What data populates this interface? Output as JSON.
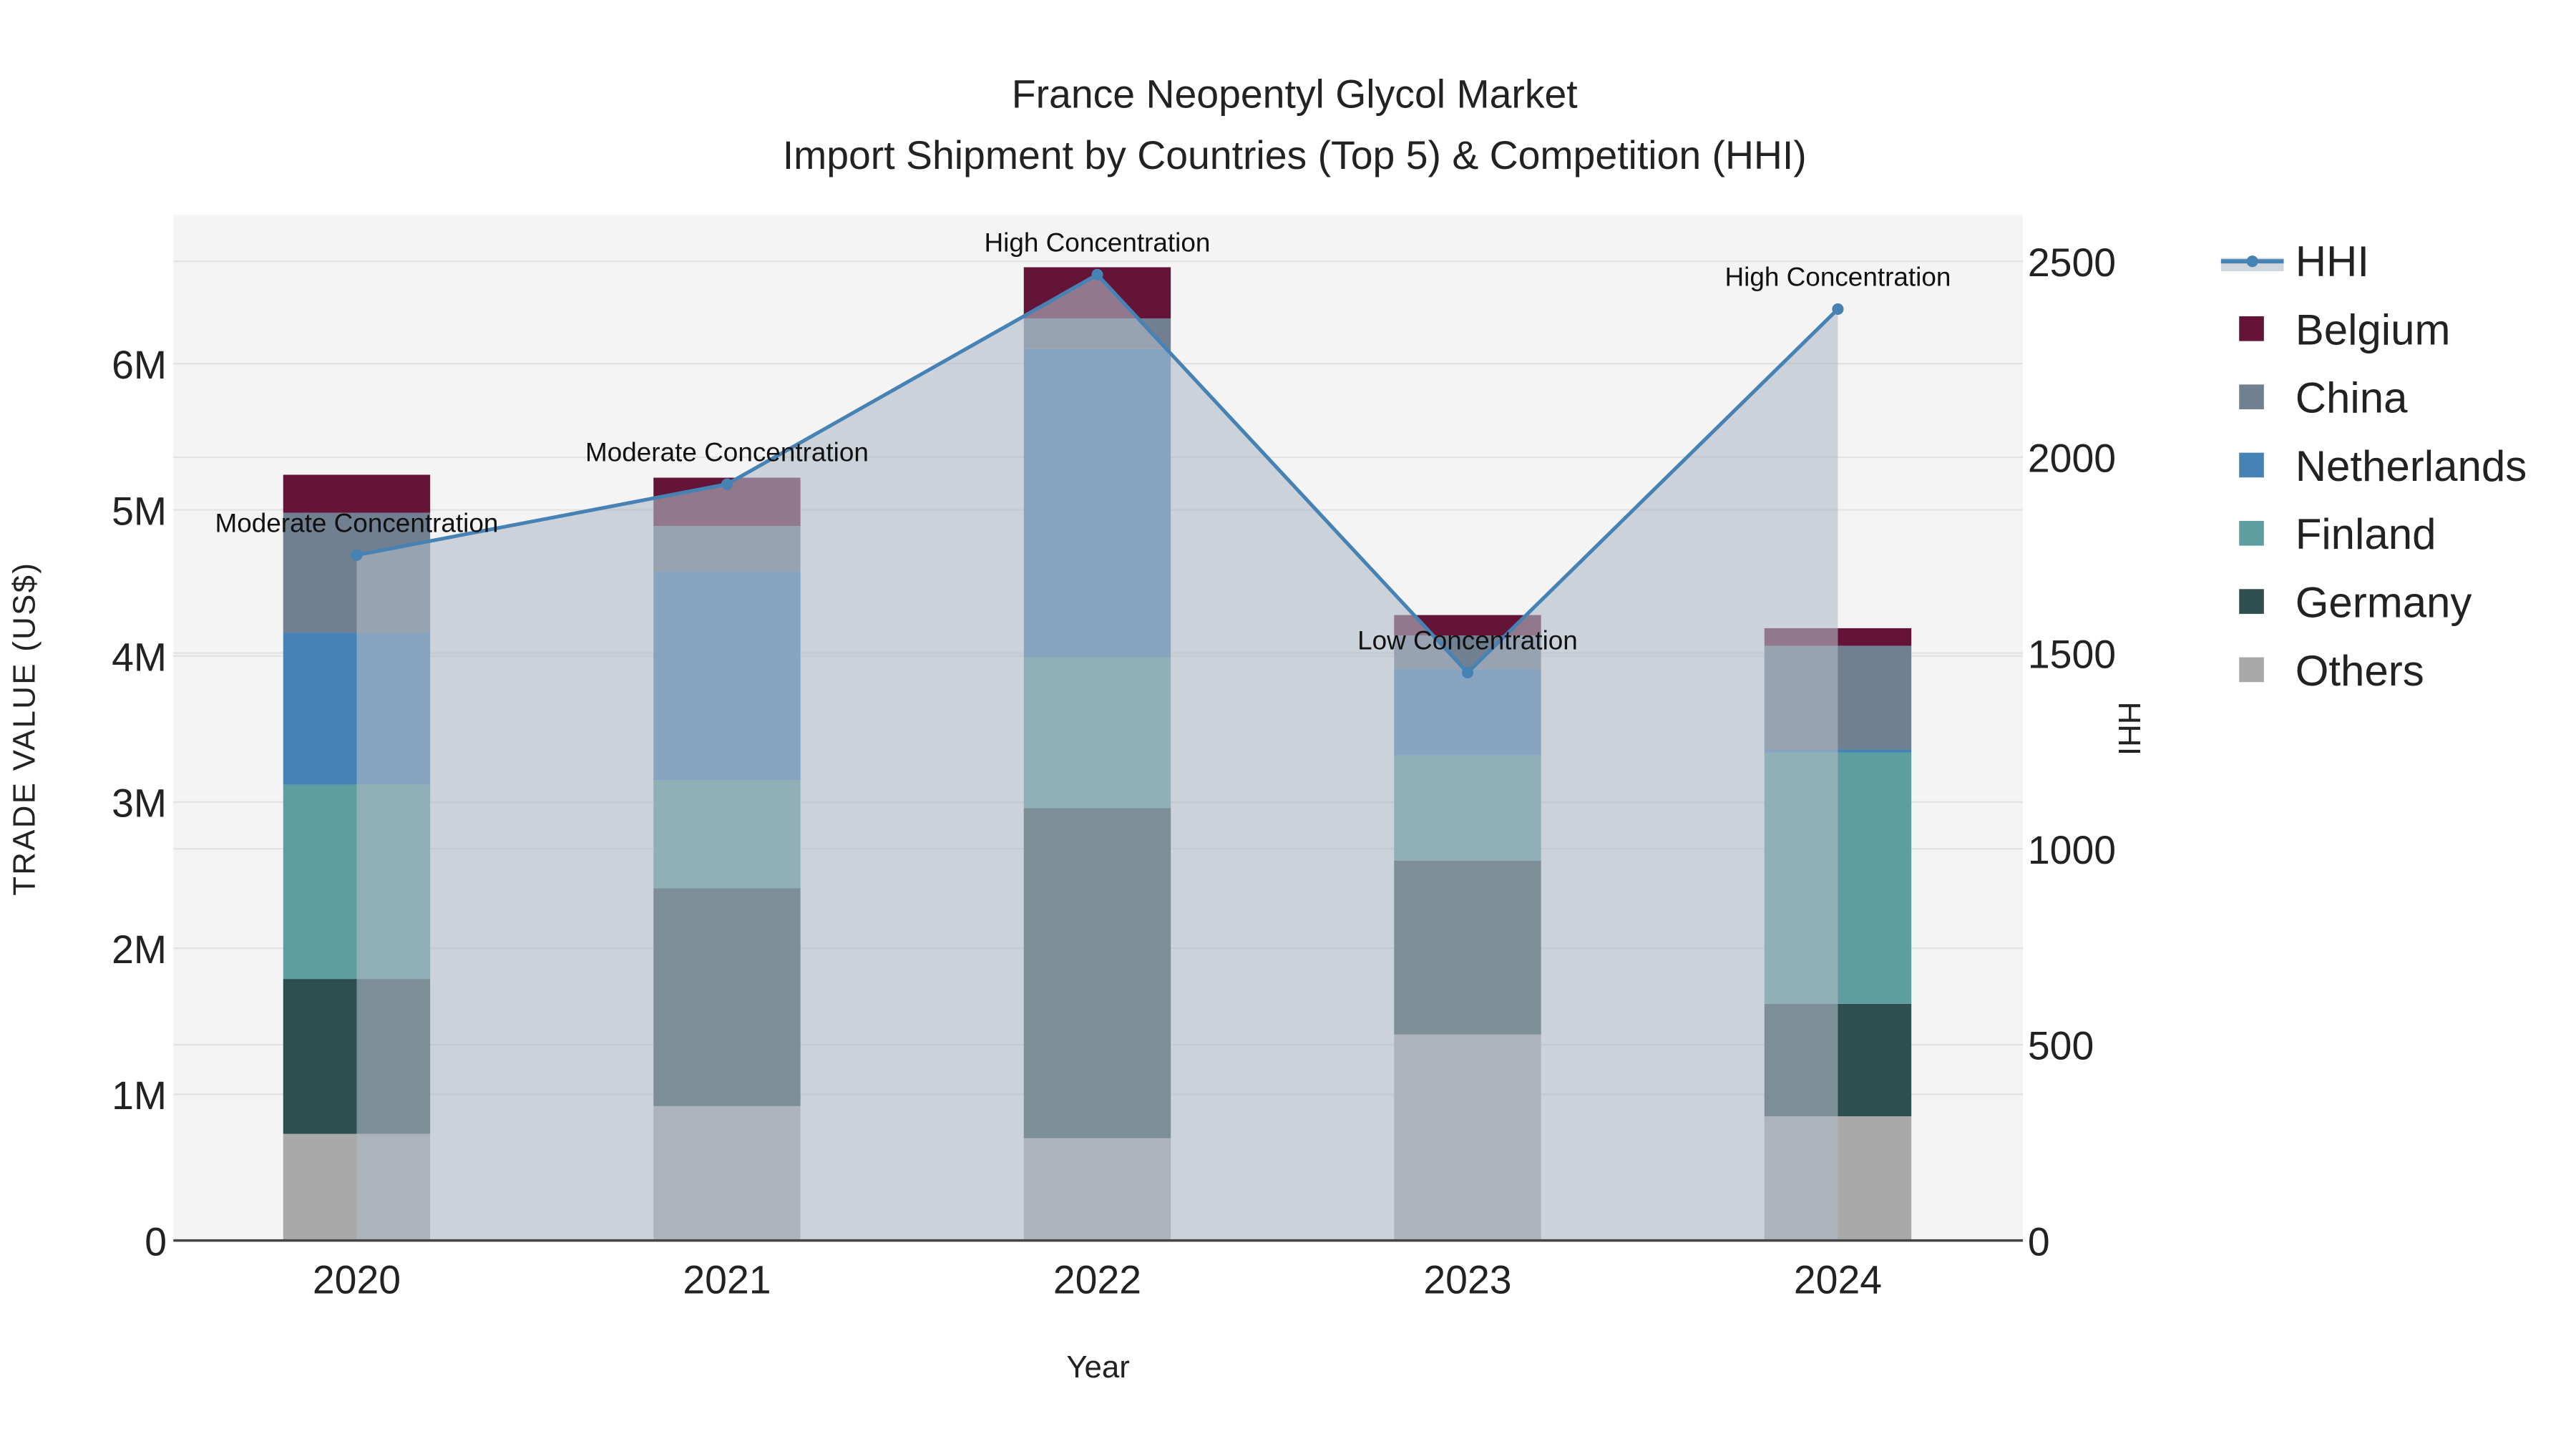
{
  "chart_data": {
    "type": "bar",
    "stacked": true,
    "title": "France Neopentyl Glycol Market",
    "subtitle": "Import Shipment by Countries (Top 5) & Competition (HHI)",
    "xlabel": "Year",
    "ylabel": "TRADE VALUE (US$)",
    "y2label": "HHI",
    "categories": [
      "2020",
      "2021",
      "2022",
      "2023",
      "2024"
    ],
    "ylim": [
      0,
      6900000
    ],
    "y2lim": [
      0,
      2610
    ],
    "yticks": [
      {
        "v": 0,
        "label": "0"
      },
      {
        "v": 1000000,
        "label": "1M"
      },
      {
        "v": 2000000,
        "label": "2M"
      },
      {
        "v": 3000000,
        "label": "3M"
      },
      {
        "v": 4000000,
        "label": "4M"
      },
      {
        "v": 5000000,
        "label": "5M"
      },
      {
        "v": 6000000,
        "label": "6M"
      }
    ],
    "y2ticks": [
      {
        "v": 0,
        "label": "0"
      },
      {
        "v": 500,
        "label": "500"
      },
      {
        "v": 1000,
        "label": "1000"
      },
      {
        "v": 1500,
        "label": "1500"
      },
      {
        "v": 2000,
        "label": "2000"
      },
      {
        "v": 2500,
        "label": "2500"
      }
    ],
    "series": [
      {
        "name": "Others",
        "color": "#a9a9a9",
        "values": [
          730000,
          920000,
          700000,
          1410000,
          850000
        ]
      },
      {
        "name": "Germany",
        "color": "#2f4f4f",
        "values": [
          1060000,
          1490000,
          2260000,
          1190000,
          770000
        ]
      },
      {
        "name": "Finland",
        "color": "#5f9ea0",
        "values": [
          1330000,
          740000,
          1030000,
          720000,
          1720000
        ]
      },
      {
        "name": "Netherlands",
        "color": "#4682b4",
        "values": [
          1040000,
          1430000,
          2110000,
          590000,
          20000
        ]
      },
      {
        "name": "China",
        "color": "#708090",
        "values": [
          820000,
          310000,
          210000,
          230000,
          710000
        ]
      },
      {
        "name": "Belgium",
        "color": "#641436",
        "values": [
          260000,
          330000,
          350000,
          140000,
          120000
        ]
      }
    ],
    "hhi": {
      "name": "HHI",
      "color": "#4682b4",
      "values": [
        1750,
        1931,
        2466,
        1450,
        2378
      ],
      "annotations": [
        "Moderate Concentration",
        "Moderate Concentration",
        "High Concentration",
        "Low Concentration",
        "High Concentration"
      ]
    },
    "legend": {
      "placement": "right",
      "items": [
        "HHI",
        "Belgium",
        "China",
        "Netherlands",
        "Finland",
        "Germany",
        "Others"
      ]
    },
    "grid": true
  }
}
